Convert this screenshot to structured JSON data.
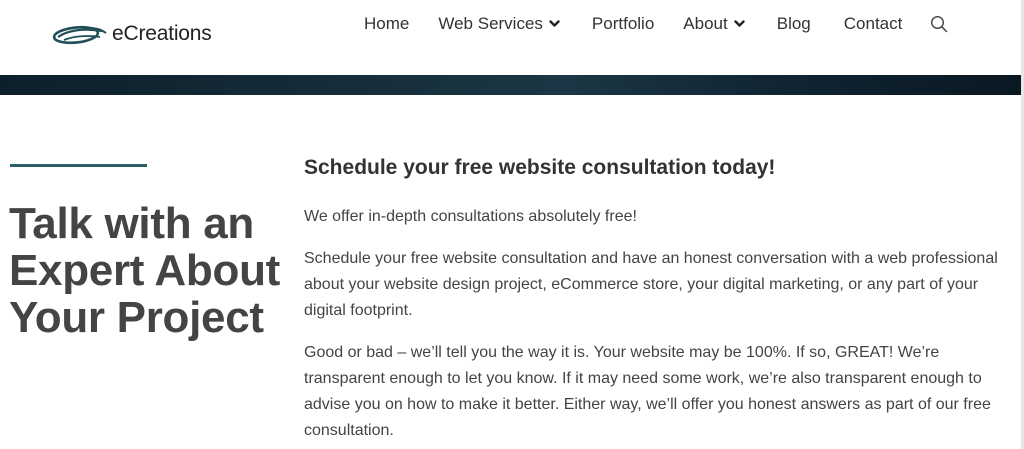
{
  "brand": {
    "name": "eCreations"
  },
  "nav": {
    "items": [
      {
        "label": "Home",
        "has_dropdown": false
      },
      {
        "label": "Web Services",
        "has_dropdown": true
      },
      {
        "label": "Portfolio",
        "has_dropdown": false
      },
      {
        "label": "About",
        "has_dropdown": true
      },
      {
        "label": "Blog",
        "has_dropdown": false
      },
      {
        "label": "Contact",
        "has_dropdown": false
      }
    ],
    "search_icon": "search-icon"
  },
  "hero": {
    "title": "Talk with an Expert About Your Project"
  },
  "content": {
    "heading": "Schedule your free website consultation today!",
    "paragraphs": [
      "We offer in-depth consultations absolutely free!",
      "Schedule your free website consultation and have an honest conversation with a web professional about your website design project, eCommerce store, your digital marketing, or any part of your digital footprint.",
      "Good or bad – we’ll tell you the way it is. Your website may be 100%. If so, GREAT! We’re transparent enough to let you know. If it may need some work, we’re also transparent enough to advise you on how to make it better. Either way, we’ll offer you honest answers as part of our free consultation."
    ]
  },
  "colors": {
    "accent": "#2b5f66",
    "band": "#152c38",
    "text": "#444444"
  }
}
